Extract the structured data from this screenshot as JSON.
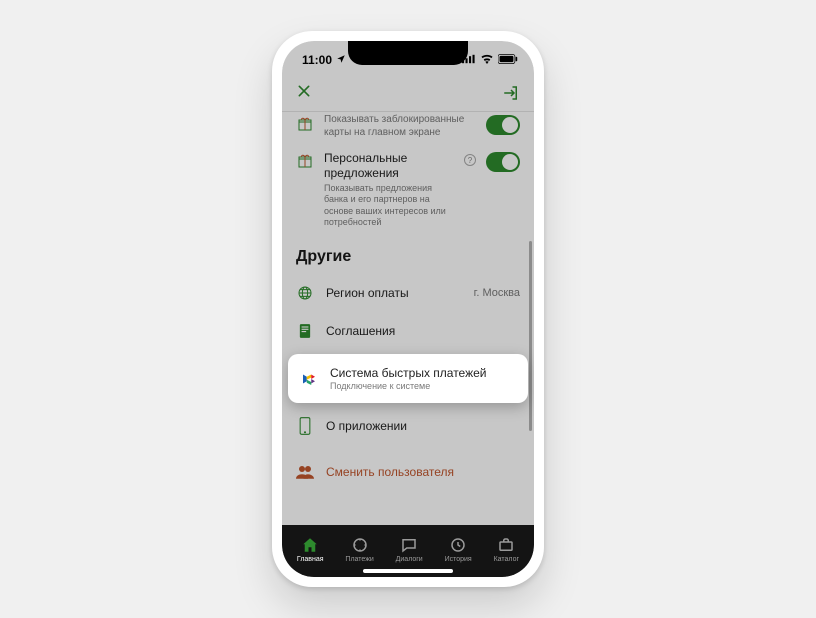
{
  "status": {
    "time": "11:00"
  },
  "settings": {
    "blocked_cards": {
      "title": "Показывать заблокированные карты на главном экране",
      "on": true
    },
    "offers": {
      "title": "Персональные предложения",
      "sub": "Показывать предложения банка и его партнеров на основе ваших интересов или потребностей",
      "on": true
    }
  },
  "section_other": "Другие",
  "rows": {
    "region": {
      "title": "Регион оплаты",
      "value": "г. Москва"
    },
    "agreements": {
      "title": "Соглашения"
    },
    "sbp": {
      "title": "Система быстрых платежей",
      "sub": "Подключение к системе"
    },
    "about": {
      "title": "О приложении"
    },
    "switch_user": {
      "title": "Сменить пользователя"
    }
  },
  "tabs": {
    "home": "Главная",
    "payments": "Платежи",
    "dialogs": "Диалоги",
    "history": "История",
    "catalog": "Каталог"
  }
}
